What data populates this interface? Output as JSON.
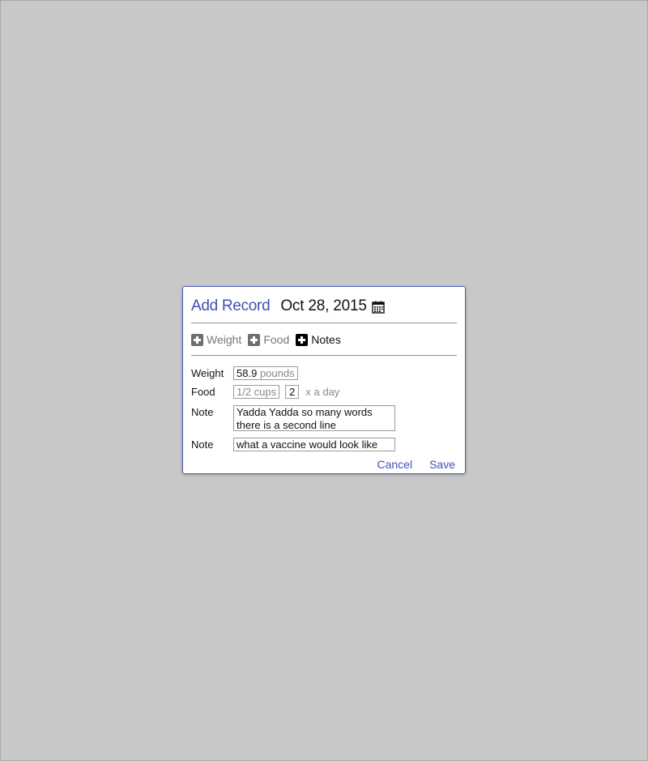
{
  "dialog": {
    "title": "Add Record",
    "date": "Oct 28, 2015",
    "calendar_icon": "calendar-icon"
  },
  "tabs": [
    {
      "label": "Weight",
      "icon": "plus-square-icon",
      "active": false
    },
    {
      "label": "Food",
      "icon": "plus-square-icon",
      "active": false
    },
    {
      "label": "Notes",
      "icon": "plus-square-icon",
      "active": true
    }
  ],
  "form": {
    "weight": {
      "label": "Weight",
      "value": "58.9",
      "unit": "pounds"
    },
    "food": {
      "label": "Food",
      "quantity": "1/2 cups",
      "times": "2",
      "suffix": "x a day"
    },
    "notes": [
      {
        "label": "Note",
        "value": "Yadda Yadda so many words\nthere is a second line"
      },
      {
        "label": "Note",
        "value": "what a vaccine would look like"
      }
    ]
  },
  "actions": {
    "cancel": "Cancel",
    "save": "Save"
  },
  "colors": {
    "accent": "#3f51b5",
    "background": "#c8c8c8"
  }
}
